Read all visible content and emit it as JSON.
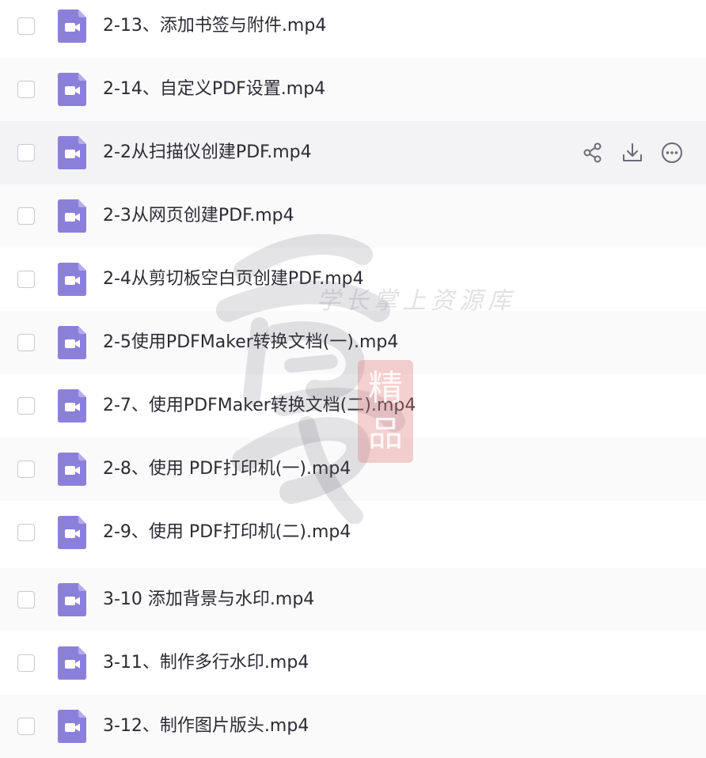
{
  "files": [
    {
      "name": "2-13、添加书签与附件.mp4"
    },
    {
      "name": "2-14、自定义PDF设置.mp4"
    },
    {
      "name": "2-2从扫描仪创建PDF.mp4"
    },
    {
      "name": "2-3从网页创建PDF.mp4"
    },
    {
      "name": "2-4从剪切板空白页创建PDF.mp4"
    },
    {
      "name": "2-5使用PDFMaker转换文档(一).mp4"
    },
    {
      "name": "2-7、使用PDFMaker转换文档(二).mp4"
    },
    {
      "name": "2-8、使用 PDF打印机(一).mp4"
    },
    {
      "name": "2-9、使用 PDF打印机(二).mp4"
    },
    {
      "name": "3-10 添加背景与水印.mp4"
    },
    {
      "name": "3-11、制作多行水印.mp4"
    },
    {
      "name": "3-12、制作图片版头.mp4"
    }
  ],
  "hovered_row_index": 2,
  "row_actions": {
    "share_icon": "share-icon",
    "download_icon": "download-icon",
    "more_icon": "more-icon"
  },
  "file_icon": "video-file-icon",
  "colors": {
    "file_icon": "#8b80d9",
    "row_hover": "#f3f3f5",
    "text": "#2b2b33",
    "action_icon": "#6a6a75"
  },
  "watermark": {
    "caption": "学长掌上资源库",
    "seal_chars": [
      "精",
      "品"
    ]
  }
}
